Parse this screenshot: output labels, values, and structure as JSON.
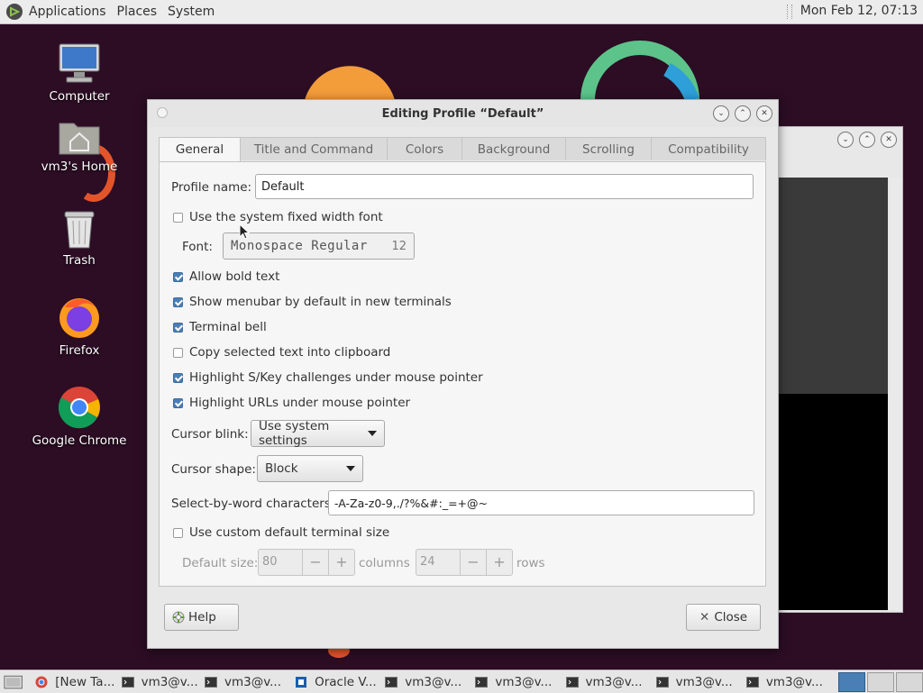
{
  "top_panel": {
    "menus": [
      "Applications",
      "Places",
      "System"
    ],
    "clock": "Mon Feb 12, 07:13"
  },
  "desktop_icons": [
    {
      "label": "Computer",
      "icon": "computer-icon"
    },
    {
      "label": "vm3's Home",
      "icon": "home-folder-icon"
    },
    {
      "label": "Trash",
      "icon": "trash-icon"
    },
    {
      "label": "Firefox",
      "icon": "firefox-icon"
    },
    {
      "label": "Google Chrome",
      "icon": "chrome-icon"
    }
  ],
  "dialog": {
    "title": "Editing Profile “Default”",
    "tabs": [
      "General",
      "Title and Command",
      "Colors",
      "Background",
      "Scrolling",
      "Compatibility"
    ],
    "active_tab": "General",
    "profile_name_label": "Profile name:",
    "profile_name_value": "Default",
    "use_system_font_label": "Use the system fixed width font",
    "use_system_font_checked": false,
    "font_label": "Font:",
    "font_name": "Monospace Regular",
    "font_size": "12",
    "checkboxes": [
      {
        "label": "Allow bold text",
        "checked": true
      },
      {
        "label": "Show menubar by default in new terminals",
        "checked": true
      },
      {
        "label": "Terminal bell",
        "checked": true
      },
      {
        "label": "Copy selected text into clipboard",
        "checked": false
      },
      {
        "label": "Highlight S/Key challenges under mouse pointer",
        "checked": true
      },
      {
        "label": "Highlight URLs under mouse pointer",
        "checked": true
      }
    ],
    "cursor_blink_label": "Cursor blink:",
    "cursor_blink_value": "Use system settings",
    "cursor_shape_label": "Cursor shape:",
    "cursor_shape_value": "Block",
    "select_by_word_label": "Select-by-word characters:",
    "select_by_word_value": "-A-Za-z0-9,./?%&#:_=+@~",
    "custom_size_label": "Use custom default terminal size",
    "custom_size_checked": false,
    "default_size_label": "Default size:",
    "columns_value": "80",
    "columns_label": "columns",
    "rows_value": "24",
    "rows_label": "rows",
    "help_button": "Help",
    "close_button": "Close"
  },
  "taskbar": {
    "items": [
      {
        "label": "[New Ta...",
        "icon": "chrome-icon"
      },
      {
        "label": "vm3@v...",
        "icon": "terminal-icon"
      },
      {
        "label": "vm3@v...",
        "icon": "terminal-icon"
      },
      {
        "label": "Oracle V...",
        "icon": "virtualbox-icon"
      },
      {
        "label": "vm3@v...",
        "icon": "terminal-icon"
      },
      {
        "label": "vm3@v...",
        "icon": "terminal-icon"
      },
      {
        "label": "vm3@v...",
        "icon": "terminal-icon"
      },
      {
        "label": "vm3@v...",
        "icon": "terminal-icon"
      },
      {
        "label": "vm3@v...",
        "icon": "terminal-icon"
      }
    ]
  }
}
